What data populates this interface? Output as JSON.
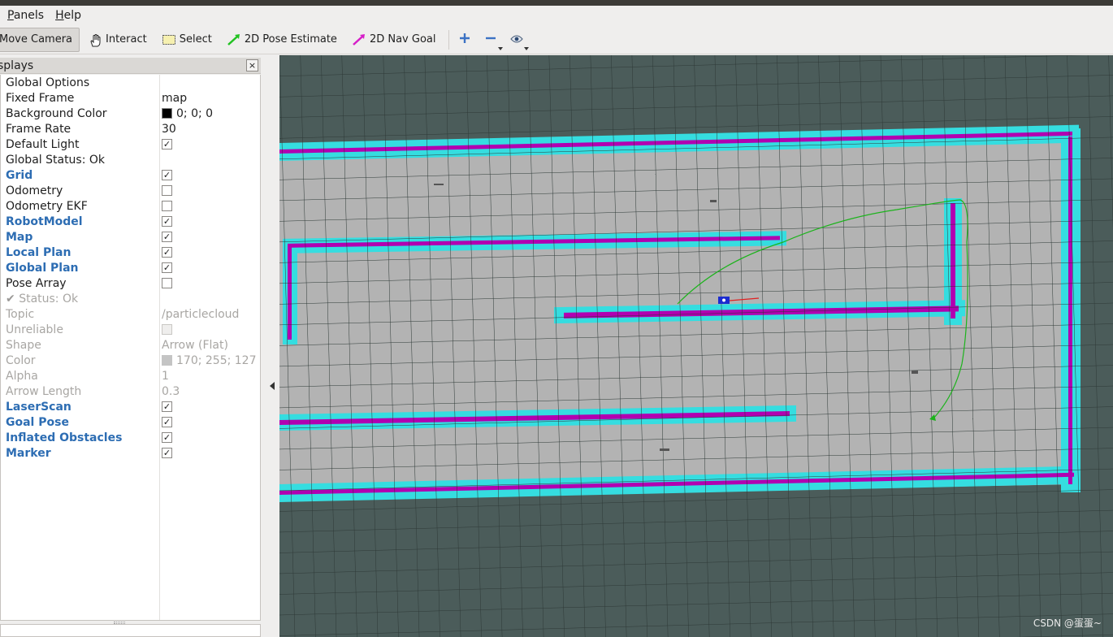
{
  "menubar": {
    "items": [
      "Panels",
      "Help"
    ]
  },
  "toolbar": {
    "move_camera": "Move Camera",
    "interact": "Interact",
    "select": "Select",
    "pose_estimate": "2D Pose Estimate",
    "nav_goal": "2D Nav Goal",
    "pose_estimate_color": "#22c222",
    "nav_goal_color": "#d61ec8"
  },
  "displays_panel": {
    "title": "splays",
    "close": "×",
    "rows": [
      {
        "name": "Global Options",
        "value": ""
      },
      {
        "name": "Fixed Frame",
        "value": "map"
      },
      {
        "name": "Background Color",
        "value": "0; 0; 0",
        "swatch": "#000000"
      },
      {
        "name": "Frame Rate",
        "value": "30"
      },
      {
        "name": "Default Light",
        "checked": true
      },
      {
        "name": "Global Status: Ok",
        "value": ""
      },
      {
        "name": "Grid",
        "checked": true
      },
      {
        "name": "Odometry",
        "checked": false
      },
      {
        "name": "Odometry EKF",
        "checked": false
      },
      {
        "name": "RobotModel",
        "checked": true
      },
      {
        "name": "Map",
        "checked": true
      },
      {
        "name": "Local Plan",
        "checked": true
      },
      {
        "name": "Global Plan",
        "checked": true
      },
      {
        "name": "Pose Array",
        "checked": false
      },
      {
        "name": "Status: Ok",
        "value": "",
        "check_mark": "✔"
      },
      {
        "name": "Topic",
        "value": "/particlecloud"
      },
      {
        "name": "Unreliable",
        "checked": false
      },
      {
        "name": "Shape",
        "value": "Arrow (Flat)"
      },
      {
        "name": "Color",
        "value": "170; 255; 127",
        "swatch": "#c4c4c4"
      },
      {
        "name": "Alpha",
        "value": "1"
      },
      {
        "name": "Arrow Length",
        "value": "0.3"
      },
      {
        "name": "LaserScan",
        "checked": true
      },
      {
        "name": "Goal Pose",
        "checked": true
      },
      {
        "name": "Inflated Obstacles",
        "checked": true
      },
      {
        "name": "Marker",
        "checked": true
      }
    ]
  },
  "viewport": {
    "background_color": "#4b5c5a",
    "map_free_color": "#b3b3b3",
    "inflation_color": "#35dde0",
    "obstacle_color": "#b100b1",
    "path_color": "#1cb31c",
    "robot_color": "#1a2bd0",
    "watermark": "CSDN @蛋蛋~"
  }
}
